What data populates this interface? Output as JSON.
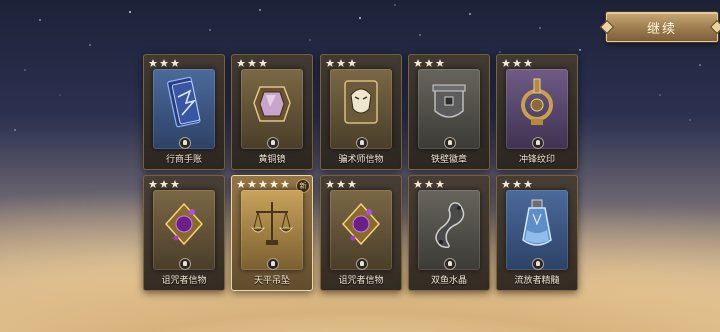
{
  "top_bar": {
    "continue_label": "继续"
  },
  "cards": [
    {
      "name": "行商手账",
      "stars": 3,
      "frame": "blue",
      "icon": "merchant-ledger-icon",
      "is_new": false
    },
    {
      "name": "黄铜镜",
      "stars": 3,
      "frame": "gold",
      "icon": "brass-mirror-icon",
      "is_new": false
    },
    {
      "name": "骗术师信物",
      "stars": 3,
      "frame": "gold",
      "icon": "trickster-token-icon",
      "is_new": false
    },
    {
      "name": "铁壁徽章",
      "stars": 3,
      "frame": "grey",
      "icon": "iron-wall-badge-icon",
      "is_new": false
    },
    {
      "name": "冲锋纹印",
      "stars": 3,
      "frame": "purple",
      "icon": "charge-seal-icon",
      "is_new": false
    },
    {
      "name": "诅咒者信物",
      "stars": 3,
      "frame": "gold",
      "icon": "cursed-token-icon",
      "is_new": false
    },
    {
      "name": "天平吊坠",
      "stars": 5,
      "frame": "brightgold",
      "icon": "scales-pendant-icon",
      "is_new": true,
      "new_label": "新"
    },
    {
      "name": "诅咒者信物",
      "stars": 3,
      "frame": "gold",
      "icon": "cursed-token-icon",
      "is_new": false
    },
    {
      "name": "双鱼水晶",
      "stars": 3,
      "frame": "grey",
      "icon": "pisces-crystal-icon",
      "is_new": false
    },
    {
      "name": "流放者精髓",
      "stars": 3,
      "frame": "blue",
      "icon": "exile-essence-icon",
      "is_new": false
    }
  ]
}
